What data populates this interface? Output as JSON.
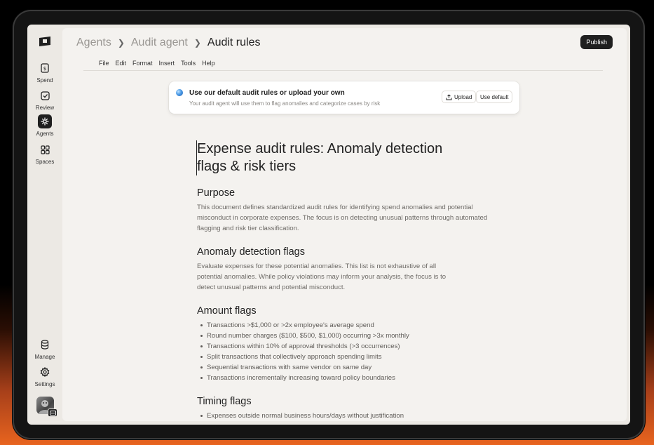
{
  "sidebar": {
    "nav": [
      {
        "label": "Spend",
        "icon": "receipt-icon"
      },
      {
        "label": "Review",
        "icon": "checkbox-icon"
      },
      {
        "label": "Agents",
        "icon": "sparkle-icon",
        "active": true
      },
      {
        "label": "Spaces",
        "icon": "grid-icon"
      }
    ],
    "bottom": [
      {
        "label": "Manage",
        "icon": "database-icon"
      },
      {
        "label": "Settings",
        "icon": "gear-icon"
      }
    ]
  },
  "breadcrumb": [
    "Agents",
    "Audit agent",
    "Audit rules"
  ],
  "publish_label": "Publish",
  "menu": [
    "File",
    "Edit",
    "Format",
    "Insert",
    "Tools",
    "Help"
  ],
  "banner": {
    "title": "Use our default audit rules or upload your own",
    "subtitle": "Your audit agent will use them to flag anomalies and categorize cases by risk",
    "upload_label": "Upload",
    "default_label": "Use default"
  },
  "document": {
    "title": "Expense audit rules: Anomaly detection flags & risk tiers",
    "purpose_heading": "Purpose",
    "purpose_text": "This document defines standardized audit rules for identifying spend anomalies and potential misconduct in corporate expenses. The focus is on detecting unusual patterns through automated flagging and risk tier classification.",
    "anomaly_heading": "Anomaly detection flags",
    "anomaly_text": "Evaluate expenses for these potential anomalies. This list is not exhaustive of all potential anomalies. While policy violations may inform your analysis, the focus is to detect unusual patterns and potential misconduct.",
    "amount_heading": "Amount flags",
    "amount_items": [
      "Transactions >$1,000 or >2x employee's average spend",
      "Round number charges ($100, $500, $1,000) occurring >3x monthly",
      "Transactions within 10% of approval thresholds (>3 occurrences)",
      "Split transactions that collectively approach spending limits",
      "Sequential transactions with same vendor on same day",
      "Transactions incrementally increasing toward policy boundaries"
    ],
    "timing_heading": "Timing flags",
    "timing_items": [
      "Expenses outside normal business hours/days without justification"
    ]
  }
}
